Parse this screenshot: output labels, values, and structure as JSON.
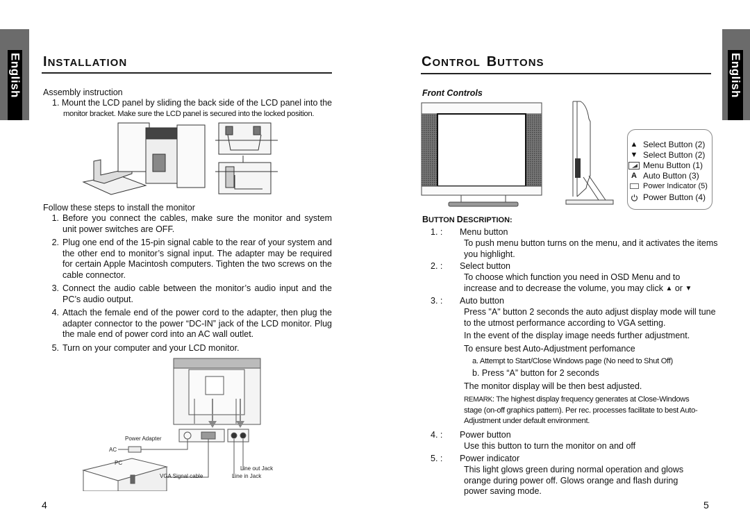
{
  "tabs": {
    "left_label": "English",
    "right_label": "English"
  },
  "left_page": {
    "title_first": "I",
    "title_rest": "NSTALLATION",
    "assembly_heading": "Assembly instruction",
    "assembly_steps": [
      {
        "num": "1.",
        "line1": "Mount the LCD panel by sliding the back side of the LCD panel into the",
        "line2": "monitor bracket. Make sure the LCD panel is secured into the locked position."
      }
    ],
    "install_heading": "Follow these steps to install the monitor",
    "install_steps": [
      {
        "num": "1.",
        "text": "Before you connect the cables, make sure the monitor and system unit power switches are OFF."
      },
      {
        "num": "2.",
        "text": "Plug one end of the 15-pin signal cable to the rear of your system and the other end to monitor’s signal input. The adapter may be required for certain Apple Macintosh computers. Tighten the two screws on the cable connector."
      },
      {
        "num": "3.",
        "text": "Connect the audio cable between the monitor’s audio input and the PC’s audio output."
      },
      {
        "num": "4.",
        "text": "Attach the female end of the power cord to the adapter, then plug the adapter connector to the power “DC-IN” jack of the LCD monitor. Plug the male end of power cord into an AC wall outlet."
      },
      {
        "num": "5.",
        "text": "Turn on your computer and your LCD monitor."
      }
    ],
    "diagram_labels": {
      "power_adapter": "Power Adapter",
      "ac": "AC",
      "pc": "PC",
      "vga_cable": "VGA Signal cable",
      "line_out": "Line out Jack",
      "line_in": "Line in Jack"
    },
    "page_number": "4"
  },
  "right_page": {
    "title_w1_first": "C",
    "title_w1_rest": "ONTROL",
    "title_w2_first": "B",
    "title_w2_rest": "UTTONS",
    "front_controls_label": "Front Controls",
    "legend": [
      {
        "icon": "triangle-up-icon",
        "glyph": "▲",
        "label": "Select Button (2)"
      },
      {
        "icon": "triangle-down-icon",
        "glyph": "▼",
        "label": "Select Button (2)"
      },
      {
        "icon": "menu-icon",
        "glyph": "",
        "label": "Menu Button (1)"
      },
      {
        "icon": "auto-a-icon",
        "glyph": "A",
        "label": "Auto Button (3)"
      },
      {
        "icon": "power-indicator-icon",
        "glyph": "",
        "label": "Power Indicator (5)"
      },
      {
        "icon": "power-icon",
        "glyph": "⏻",
        "label": "Power Button (4)"
      }
    ],
    "button_desc_heading_b": "B",
    "button_desc_heading_1": "UTTON ",
    "button_desc_heading_d": "D",
    "button_desc_heading_2": "ESCRIPTION:",
    "descriptions": {
      "d1_num": "1.  :",
      "d1_title": "Menu button",
      "d1_text": "To push menu button turns on the menu, and it activates the items you highlight.",
      "d2_num": "2.  :",
      "d2_title": "Select button",
      "d2_line1": "To choose which function you need in OSD Menu and to",
      "d2_line2": "increase and to decrease the volume, you may click",
      "d2_or": "or",
      "d3_num": "3.  :",
      "d3_title": "Auto button",
      "d3_text1": "Press \"A\" button 2 seconds the auto adjust display mode will tune to the utmost performance according to VGA setting.",
      "d3_text2": "In the event of the display image needs further adjustment.",
      "d3_text3": "To ensure best Auto-Adjustment perfomance",
      "d3_sub_a": "a. Attempt to Start/Close Windows page (No need to Shut Off)",
      "d3_sub_b": "b. Press “A” button for 2 seconds",
      "d3_text4": "The monitor display will be then best adjusted.",
      "d3_remark_label": "REMARK",
      "d3_remark": ": The highest display frequency generates at Close-Windows stage (on-off graphics pattern). Per rec. processes facilitate to best Auto-Adjustment under default environment.",
      "d4_num": "4.  :",
      "d4_title": "Power button",
      "d4_text": "Use this button to turn the monitor on and off",
      "d5_num": "5.  :",
      "d5_title": "Power indicator",
      "d5_text": "This light glows green during normal operation and glows orange during power off. Glows orange and flash during power saving mode."
    },
    "page_number": "5"
  }
}
